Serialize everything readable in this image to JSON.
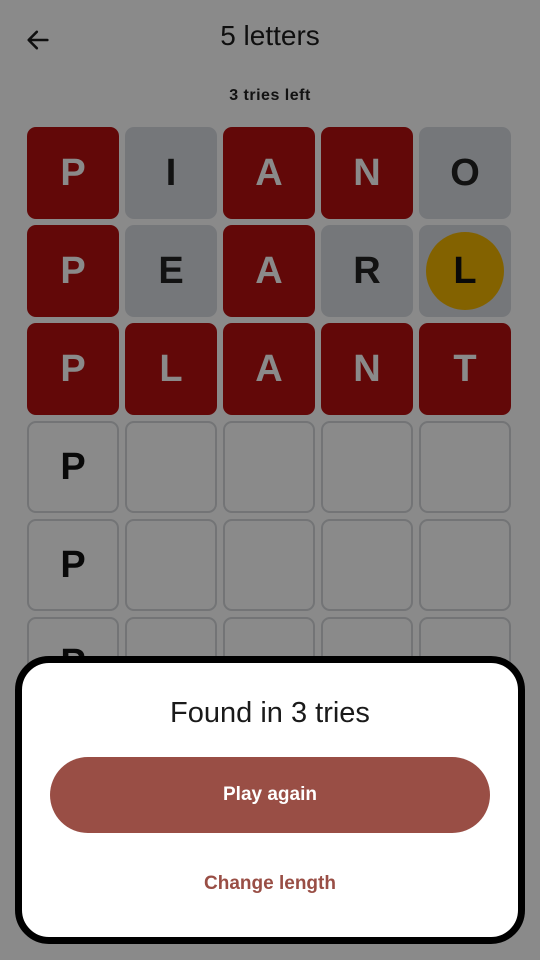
{
  "header": {
    "title": "5 letters",
    "back_icon": "arrow-left-icon"
  },
  "status": {
    "tries_left": "3 tries left"
  },
  "board": {
    "rows": [
      [
        {
          "letter": "P",
          "state": "red"
        },
        {
          "letter": "I",
          "state": "grey"
        },
        {
          "letter": "A",
          "state": "red"
        },
        {
          "letter": "N",
          "state": "red"
        },
        {
          "letter": "O",
          "state": "grey"
        }
      ],
      [
        {
          "letter": "P",
          "state": "red"
        },
        {
          "letter": "E",
          "state": "grey"
        },
        {
          "letter": "A",
          "state": "red"
        },
        {
          "letter": "R",
          "state": "grey"
        },
        {
          "letter": "L",
          "state": "yellow-circle"
        }
      ],
      [
        {
          "letter": "P",
          "state": "red"
        },
        {
          "letter": "L",
          "state": "red"
        },
        {
          "letter": "A",
          "state": "red"
        },
        {
          "letter": "N",
          "state": "red"
        },
        {
          "letter": "T",
          "state": "red"
        }
      ],
      [
        {
          "letter": "P",
          "state": "empty"
        },
        {
          "letter": "",
          "state": "empty"
        },
        {
          "letter": "",
          "state": "empty"
        },
        {
          "letter": "",
          "state": "empty"
        },
        {
          "letter": "",
          "state": "empty"
        }
      ],
      [
        {
          "letter": "P",
          "state": "empty"
        },
        {
          "letter": "",
          "state": "empty"
        },
        {
          "letter": "",
          "state": "empty"
        },
        {
          "letter": "",
          "state": "empty"
        },
        {
          "letter": "",
          "state": "empty"
        }
      ],
      [
        {
          "letter": "P",
          "state": "empty"
        },
        {
          "letter": "",
          "state": "empty"
        },
        {
          "letter": "",
          "state": "empty"
        },
        {
          "letter": "",
          "state": "empty"
        },
        {
          "letter": "",
          "state": "empty"
        }
      ]
    ]
  },
  "dialog": {
    "title": "Found in 3 tries",
    "play_again_label": "Play again",
    "change_length_label": "Change length"
  },
  "colors": {
    "correct": "#b50f0f",
    "absent": "#d9dde1",
    "present": "#f2b500",
    "accent": "#994e45"
  }
}
